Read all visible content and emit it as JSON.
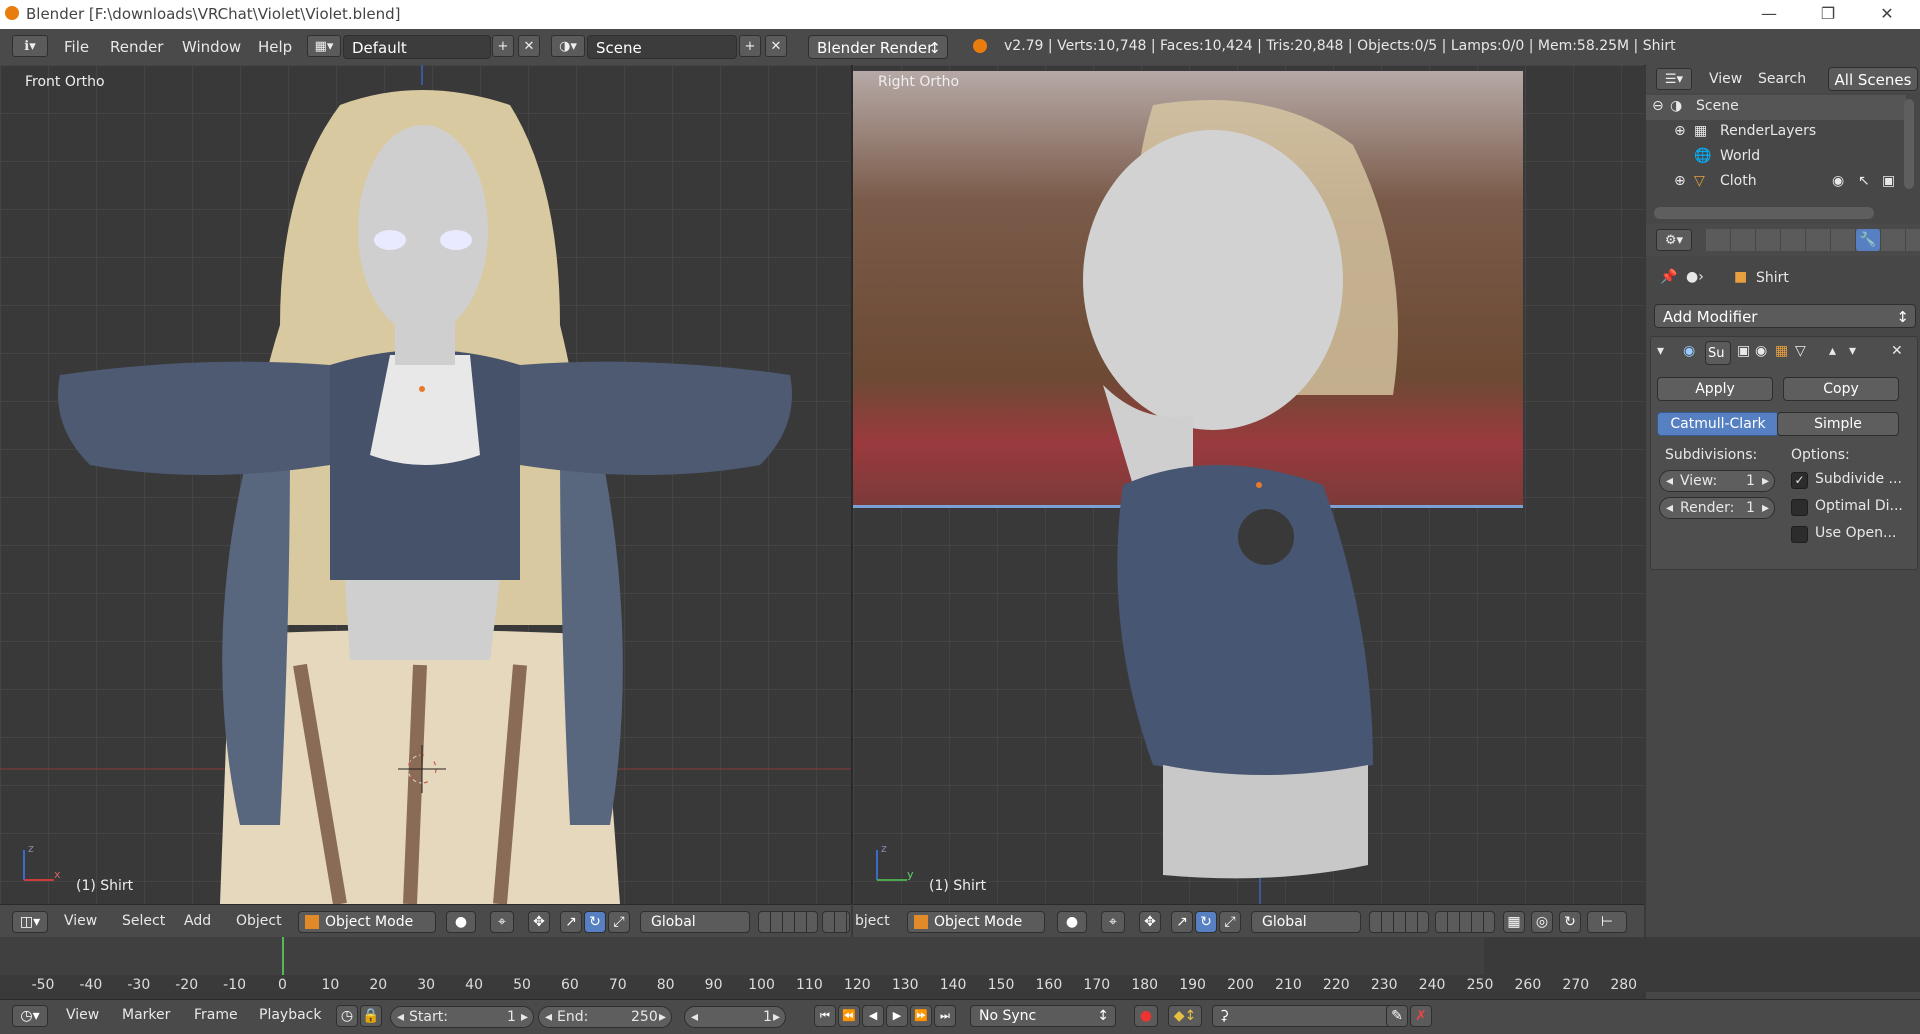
{
  "window": {
    "title": "Blender [F:\\downloads\\VRChat\\Violet\\Violet.blend]"
  },
  "info_header": {
    "menus": [
      "File",
      "Render",
      "Window",
      "Help"
    ],
    "screen_layout": "Default",
    "scene": "Scene",
    "render_engine": "Blender Render",
    "stats": "v2.79 | Verts:10,748 | Faces:10,424 | Tris:20,848 | Objects:0/5 | Lamps:0/0 | Mem:58.25M | Shirt"
  },
  "viewport_left": {
    "label": "Front Ortho",
    "object_label": "(1) Shirt",
    "header": {
      "menus": [
        "View",
        "Select",
        "Add",
        "Object"
      ],
      "mode": "Object Mode",
      "orientation": "Global"
    },
    "axis": {
      "z": "z",
      "x": "x"
    }
  },
  "viewport_right": {
    "label": "Right Ortho",
    "object_label": "(1) Shirt",
    "header": {
      "partial_menu": "bject",
      "mode": "Object Mode",
      "orientation": "Global"
    },
    "axis": {
      "z": "z",
      "y": "y"
    }
  },
  "outliner": {
    "menus": [
      "View",
      "Search"
    ],
    "filter": "All Scenes",
    "items": [
      "Scene",
      "RenderLayers",
      "World",
      "Cloth"
    ]
  },
  "properties": {
    "object_name": "Shirt",
    "add_modifier": "Add Modifier",
    "modifier_name_partial": "Su",
    "apply_label": "Apply",
    "copy_label": "Copy",
    "type_catmull": "Catmull-Clark",
    "type_simple": "Simple",
    "subdivisions_label": "Subdivisions:",
    "options_label": "Options:",
    "view_label": "View:",
    "view_value": "1",
    "render_label": "Render:",
    "render_value": "1",
    "opt_subdivide": "Subdivide ...",
    "opt_optimal": "Optimal Di...",
    "opt_useopen": "Use Open...",
    "subdivide_checked": true,
    "optimal_checked": false,
    "useopen_checked": false
  },
  "timeline": {
    "ticks": [
      "-50",
      "-40",
      "-30",
      "-20",
      "-10",
      "0",
      "10",
      "20",
      "30",
      "40",
      "50",
      "60",
      "70",
      "80",
      "90",
      "100",
      "110",
      "120",
      "130",
      "140",
      "150",
      "160",
      "170",
      "180",
      "190",
      "200",
      "210",
      "220",
      "230",
      "240",
      "250",
      "260",
      "270",
      "280"
    ],
    "menus": [
      "View",
      "Marker",
      "Frame",
      "Playback"
    ],
    "start_label": "Start:",
    "start_value": "1",
    "end_label": "End:",
    "end_value": "250",
    "current_frame": "1",
    "sync": "No Sync"
  },
  "colors": {
    "accent": "#5680c2",
    "header": "#4a4a4a",
    "viewport": "#393939",
    "cursor": "#e8792b"
  }
}
